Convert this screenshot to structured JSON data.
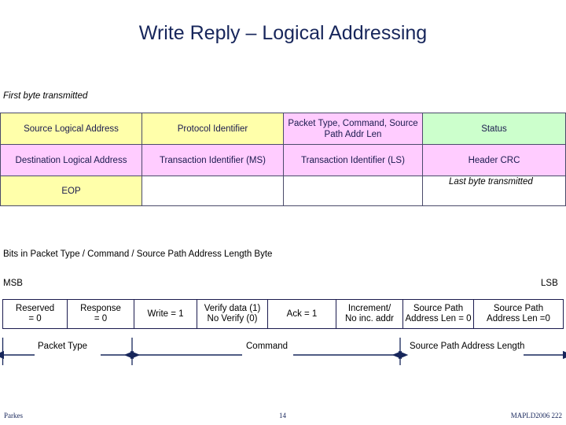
{
  "slide": {
    "title": "Write Reply – Logical Addressing",
    "title_color": "#17265B"
  },
  "captions": {
    "first_byte": "First byte transmitted",
    "last_byte": "Last byte transmitted"
  },
  "packet_table": {
    "colors": {
      "yellow": "#FFFFAA",
      "pink": "#FFCCFF",
      "green": "#CCFFCC",
      "border": "#4A4A6A",
      "text": "#1A1A4E"
    },
    "rows": [
      {
        "cells": [
          {
            "label": "Source Logical Address",
            "fill": "yellow"
          },
          {
            "label": "Protocol Identifier",
            "fill": "yellow"
          },
          {
            "label": "Packet Type, Command, Source Path Addr Len",
            "fill": "pink"
          },
          {
            "label": "Status",
            "fill": "green"
          }
        ]
      },
      {
        "cells": [
          {
            "label": "Destination Logical Address",
            "fill": "pink"
          },
          {
            "label": "Transaction Identifier (MS)",
            "fill": "pink"
          },
          {
            "label": "Transaction Identifier (LS)",
            "fill": "pink"
          },
          {
            "label": "Header CRC",
            "fill": "pink"
          }
        ]
      },
      {
        "cells": [
          {
            "label": "EOP",
            "fill": "yellow"
          },
          {
            "label": "",
            "fill": "blank"
          },
          {
            "label": "",
            "fill": "blank"
          },
          {
            "label": "",
            "fill": "blank"
          }
        ]
      }
    ]
  },
  "bits_section": {
    "heading": "Bits in Packet Type / Command / Source Path Address Length Byte",
    "msb": "MSB",
    "lsb": "LSB",
    "cells": [
      "Reserved\n= 0",
      "Response\n= 0",
      "Write = 1",
      "Verify data (1)\nNo Verify (0)",
      "Ack = 1",
      "Increment/\nNo inc. addr",
      "Source Path\nAddress Len = 0",
      "Source Path\nAddress Len =0"
    ],
    "groups": [
      {
        "label": "Packet Type"
      },
      {
        "label": "Command"
      },
      {
        "label": "Source Path Address Length"
      }
    ]
  },
  "footer": {
    "author": "Parkes",
    "page": "14",
    "conference": "MAPLD2006 222"
  }
}
